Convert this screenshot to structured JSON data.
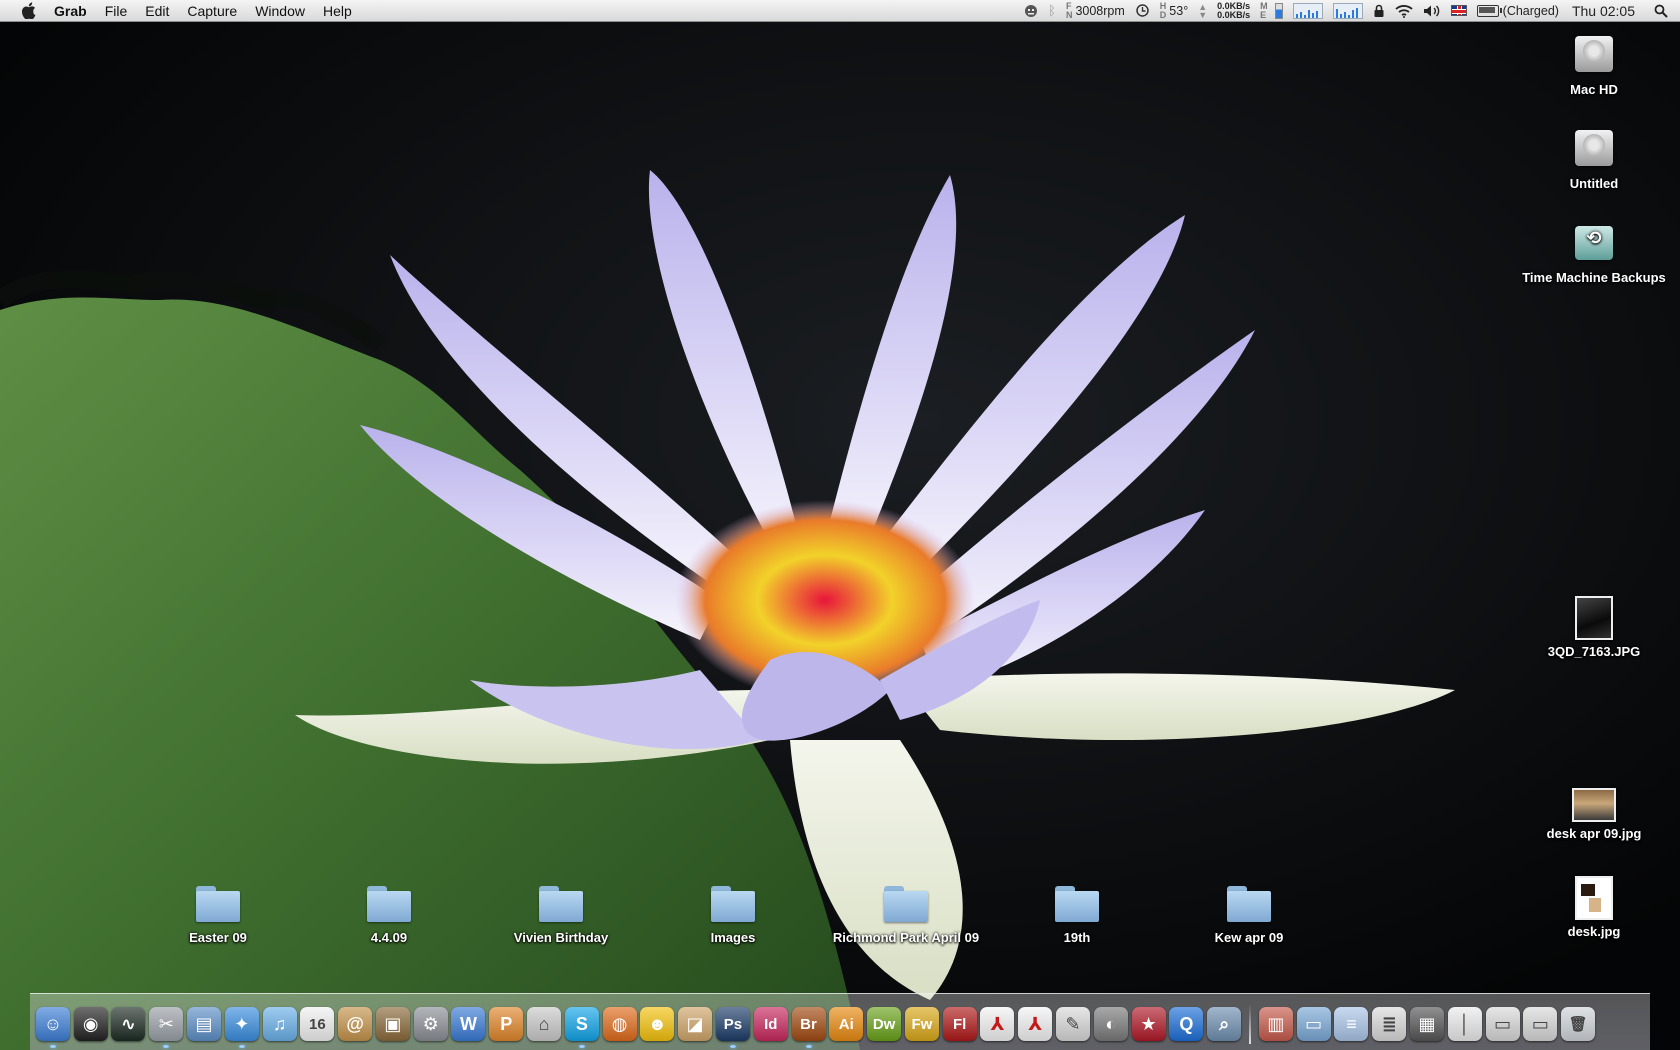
{
  "menubar": {
    "app_name": "Grab",
    "menus": [
      "File",
      "Edit",
      "Capture",
      "Window",
      "Help"
    ],
    "status": {
      "fan": "3008rpm",
      "temp": "53°",
      "net_up": "0.0KB/s",
      "net_down": "0.0KB/s",
      "battery": "(Charged)",
      "clock": "Thu 02:05"
    }
  },
  "desktop": {
    "volumes": [
      {
        "label": "Mac HD",
        "icon": "hard-drive-icon"
      },
      {
        "label": "Untitled",
        "icon": "hard-drive-icon"
      },
      {
        "label": "Time Machine Backups",
        "icon": "time-machine-drive-icon"
      }
    ],
    "files": [
      {
        "label": "3QD_7163.JPG",
        "icon": "image-file-icon"
      },
      {
        "label": "desk apr 09.jpg",
        "icon": "image-file-icon"
      },
      {
        "label": "desk.jpg",
        "icon": "image-file-icon"
      }
    ],
    "folders": [
      {
        "label": "Easter 09"
      },
      {
        "label": "4.4.09"
      },
      {
        "label": "Vivien Birthday"
      },
      {
        "label": "Images"
      },
      {
        "label": "Richmond Park April 09"
      },
      {
        "label": "19th"
      },
      {
        "label": "Kew apr 09"
      }
    ]
  },
  "dock": {
    "apps": [
      {
        "icon": "finder-icon",
        "color": "#3d7fd6",
        "glyph": "☺",
        "running": true
      },
      {
        "icon": "dashboard-icon",
        "color": "#222222",
        "glyph": "◉",
        "running": false
      },
      {
        "icon": "activity-monitor-icon",
        "color": "#1d2b24",
        "glyph": "∿",
        "running": false
      },
      {
        "icon": "grab-icon",
        "color": "#9aa0a8",
        "glyph": "✂",
        "running": true
      },
      {
        "icon": "preview-icon",
        "color": "#5d8fc7",
        "glyph": "▤",
        "running": false
      },
      {
        "icon": "safari-icon",
        "color": "#3a8ee0",
        "glyph": "✦",
        "running": true
      },
      {
        "icon": "itunes-icon",
        "color": "#6ab0e8",
        "glyph": "♫",
        "running": false
      },
      {
        "icon": "ical-icon",
        "color": "#f0f0f0",
        "glyph": "16",
        "running": false
      },
      {
        "icon": "address-book-icon",
        "color": "#c4934b",
        "glyph": "@",
        "running": false
      },
      {
        "icon": "iphoto-icon",
        "color": "#8a6a3a",
        "glyph": "▣",
        "running": false
      },
      {
        "icon": "system-preferences-icon",
        "color": "#8a8f96",
        "glyph": "⚙",
        "running": false
      },
      {
        "icon": "word-icon",
        "color": "#3a7bd5",
        "glyph": "W",
        "running": false
      },
      {
        "icon": "powerpoint-icon",
        "color": "#e0862a",
        "glyph": "P",
        "running": false
      },
      {
        "icon": "app-store-icon",
        "color": "#c9c9c9",
        "glyph": "⌂",
        "running": false
      },
      {
        "icon": "skype-icon",
        "color": "#12a5e8",
        "glyph": "S",
        "running": true
      },
      {
        "icon": "firefox-icon",
        "color": "#e06b1c",
        "glyph": "◍",
        "running": false
      },
      {
        "icon": "adium-icon",
        "color": "#f4c20d",
        "glyph": "☻",
        "running": false
      },
      {
        "icon": "photo-viewer-icon",
        "color": "#cfa56a",
        "glyph": "◪",
        "running": false
      },
      {
        "icon": "photoshop-icon",
        "color": "#1c3c68",
        "glyph": "Ps",
        "running": true
      },
      {
        "icon": "indesign-icon",
        "color": "#c8285f",
        "glyph": "Id",
        "running": false
      },
      {
        "icon": "bridge-icon",
        "color": "#a24a10",
        "glyph": "Br",
        "running": true
      },
      {
        "icon": "illustrator-icon",
        "color": "#e88a10",
        "glyph": "Ai",
        "running": false
      },
      {
        "icon": "dreamweaver-icon",
        "color": "#6aa21a",
        "glyph": "Dw",
        "running": false
      },
      {
        "icon": "fireworks-icon",
        "color": "#d9a818",
        "glyph": "Fw",
        "running": false
      },
      {
        "icon": "flash-icon",
        "color": "#b01919",
        "glyph": "Fl",
        "running": false
      },
      {
        "icon": "acrobat-icon",
        "color": "#f2f2f2",
        "glyph": "⅄",
        "running": false
      },
      {
        "icon": "acrobat-reader-icon",
        "color": "#f2f2f2",
        "glyph": "⅄",
        "running": false
      },
      {
        "icon": "script-editor-icon",
        "color": "#d8d8d8",
        "glyph": "✎",
        "running": false
      },
      {
        "icon": "globe-icon",
        "color": "#7a7a7a",
        "glyph": "◐",
        "running": false
      },
      {
        "icon": "front-row-icon",
        "color": "#b01928",
        "glyph": "★",
        "running": false
      },
      {
        "icon": "quicktime-icon",
        "color": "#1d6fd8",
        "glyph": "Q",
        "running": false
      },
      {
        "icon": "image-capture-icon",
        "color": "#6f8fb0",
        "glyph": "⌕",
        "running": false
      }
    ],
    "stacks": [
      {
        "icon": "document-stack-icon",
        "color": "#c65a4a",
        "glyph": "▥"
      },
      {
        "icon": "applications-folder-icon",
        "color": "#7aa8d6",
        "glyph": "▭"
      },
      {
        "icon": "documents-folder-icon",
        "color": "#a9c5e8",
        "glyph": "≡"
      },
      {
        "icon": "downloads-stack-icon",
        "color": "#d9d9d9",
        "glyph": "≣"
      },
      {
        "icon": "pictures-stack-icon",
        "color": "#555555",
        "glyph": "▦"
      },
      {
        "icon": "text-file-icon",
        "color": "#eaeaea",
        "glyph": "│"
      },
      {
        "icon": "window-stack-icon",
        "color": "#d8d8d8",
        "glyph": "▭"
      },
      {
        "icon": "finder-window-stack-icon",
        "color": "#d8d8d8",
        "glyph": "▭"
      },
      {
        "icon": "trash-icon",
        "color": "#cfd3d8",
        "glyph": "🗑"
      }
    ]
  }
}
